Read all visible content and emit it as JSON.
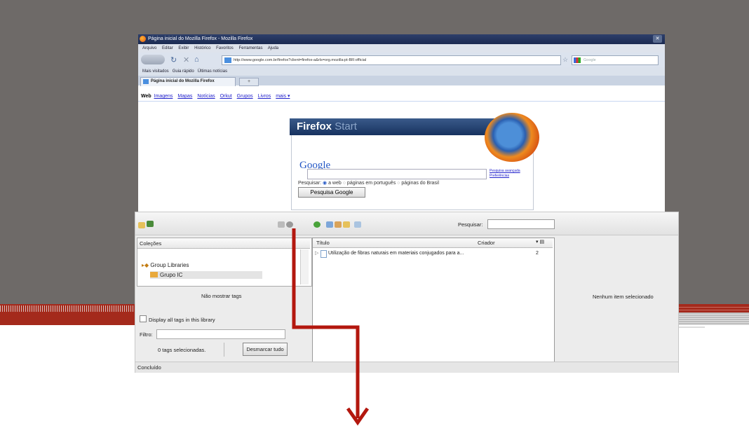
{
  "firefox": {
    "window_title": "Página inicial do Mozilla Firefox - Mozilla Firefox",
    "menu": [
      "Arquivo",
      "Editar",
      "Exibir",
      "Histórico",
      "Favoritos",
      "Ferramentas",
      "Ajuda"
    ],
    "url": "http://www.google.com.br/firefox?client=firefox-a&rls=org.mozilla:pt-BR:official",
    "search_placeholder": "Google",
    "bookmarks": [
      "Mais visitados",
      "Guia rápido",
      "Últimas notícias"
    ],
    "tab_title": "Página inicial do Mozilla Firefox",
    "new_tab": "+"
  },
  "google_bar": {
    "active": "Web",
    "links": [
      "Imagens",
      "Mapas",
      "Notícias",
      "Orkut",
      "Grupos",
      "Livros",
      "mais ▾"
    ]
  },
  "firefox_start": {
    "banner_word1": "Firefox",
    "banner_word2": "Start",
    "google_logo": "Google",
    "advanced_search": "Pesquisa avançada",
    "preferences": "Preferências",
    "radios_label": "Pesquisar:",
    "radio_options": [
      "a web",
      "páginas em português",
      "páginas do Brasil"
    ],
    "search_button": "Pesquisa Google"
  },
  "zotero": {
    "search_label": "Pesquisar:",
    "collections_header": "Coleções",
    "group_libraries": "Group Libraries",
    "group_ic": "Grupo IC",
    "no_tags": "Não mostrar tags",
    "display_all_tags": "Display all tags in this library",
    "filter_label": "Filtro:",
    "tags_selected": "0 tags selecionadas.",
    "deselect_all": "Desmarcar tudo",
    "columns": {
      "title": "Título",
      "creator": "Criador"
    },
    "items": [
      {
        "title": "Utilização de fibras naturais em materiais conjugados para a...",
        "count": "2"
      }
    ],
    "no_item_selected": "Nenhum item selecionado",
    "status": "Concluído"
  },
  "colors": {
    "slide_bg": "#6e6a68",
    "stripe": "#a42a1c",
    "arrow": "#b3170e"
  }
}
